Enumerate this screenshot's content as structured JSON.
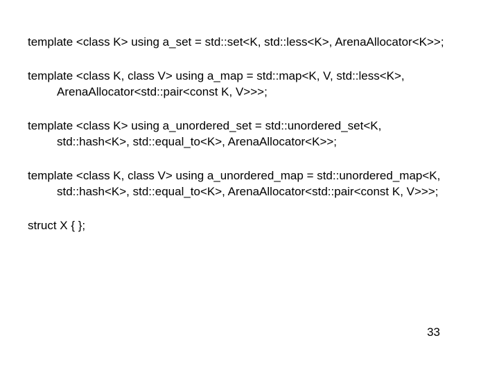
{
  "lines": {
    "l1": "template <class K> using a_set = std::set<K, std::less<K>, ArenaAllocator<K>>;",
    "l2a": "template <class K, class V> using a_map = std::map<K, V, std::less<K>,",
    "l2b": "ArenaAllocator<std::pair<const K, V>>>;",
    "l3a": "template <class K> using a_unordered_set = std::unordered_set<K,",
    "l3b": "std::hash<K>, std::equal_to<K>, ArenaAllocator<K>>;",
    "l4a": "template <class K, class V> using a_unordered_map = std::unordered_map<K,",
    "l4b": "std::hash<K>, std::equal_to<K>, ArenaAllocator<std::pair<const K, V>>>;",
    "l5": "struct X { };"
  },
  "page_number": "33"
}
